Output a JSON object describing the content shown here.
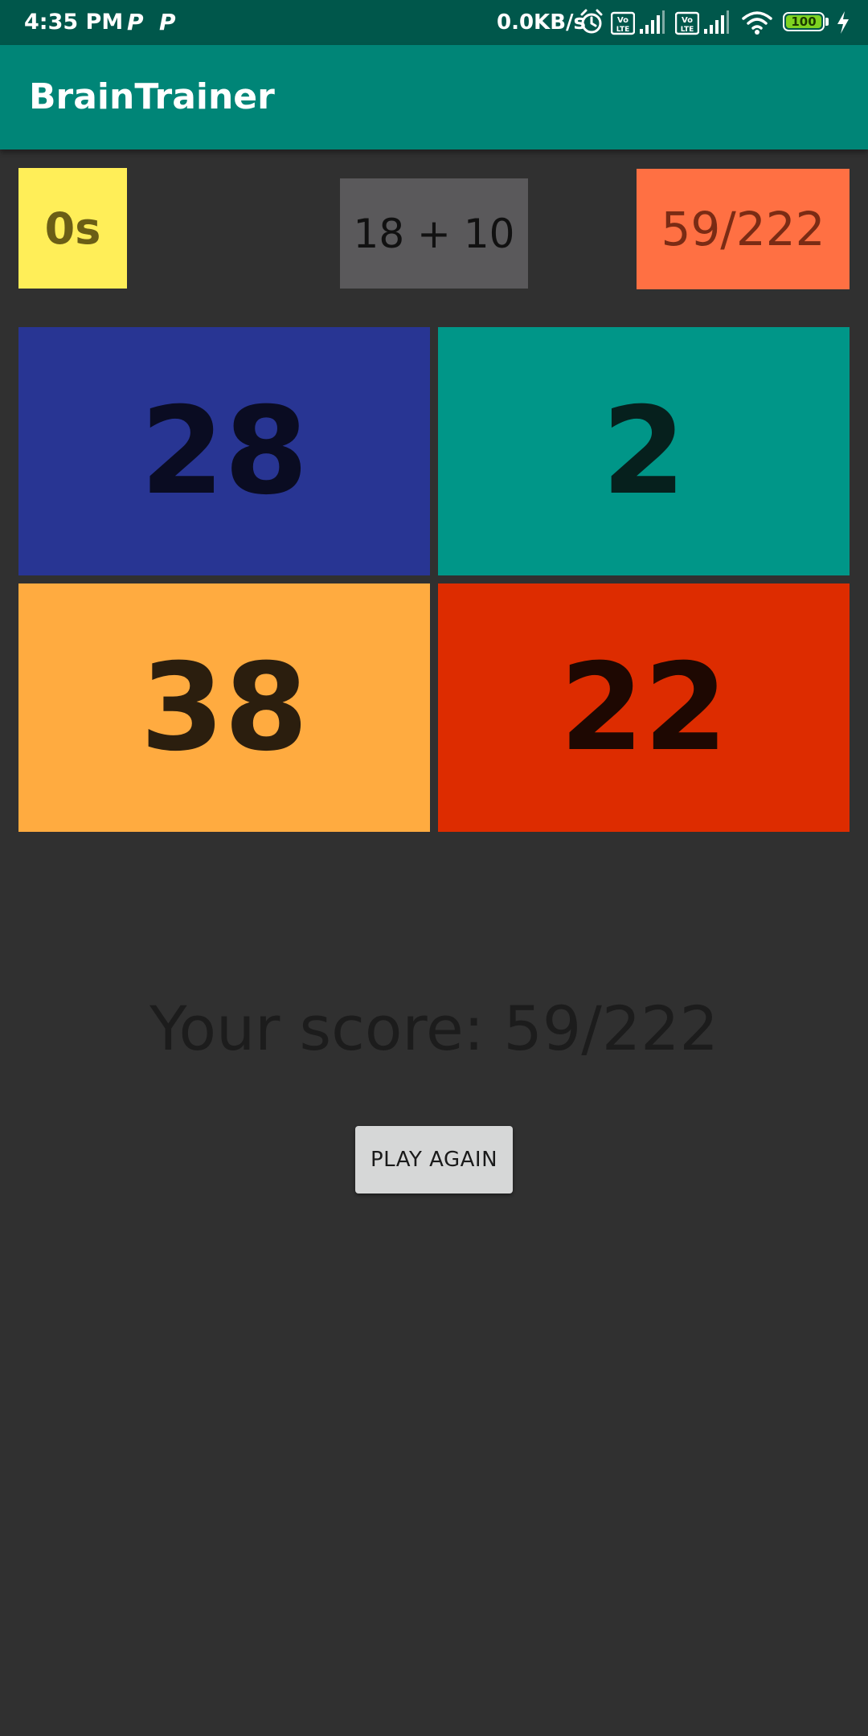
{
  "status_bar": {
    "time": "4:35 PM",
    "notification_icons": [
      "parking-p-icon",
      "parking-p-icon"
    ],
    "p_glyph": "P",
    "network_speed": "0.0KB/s",
    "icons": [
      "alarm-icon",
      "volte-icon",
      "signal-icon",
      "volte-icon",
      "signal-icon",
      "wifi-icon",
      "battery-icon",
      "charging-icon"
    ],
    "volte_label": "Vo LTE",
    "battery_level": "100",
    "battery_fraction": 1.0
  },
  "app_bar": {
    "title": "BrainTrainer"
  },
  "game": {
    "timer": "0s",
    "question": "18 + 10",
    "score": "59/222",
    "answers": [
      "28",
      "2",
      "38",
      "22"
    ],
    "result": "Your score: 59/222",
    "play_again_label": "PLAY AGAIN"
  },
  "colors": {
    "status_bar": "#00574b",
    "app_bar": "#008577",
    "background": "#303030",
    "timer": "#ffee58",
    "question": "#5a595b",
    "score": "#ff7043",
    "answer_0": "#283593",
    "answer_1": "#009688",
    "answer_2": "#ffab40",
    "answer_3": "#dd2c00",
    "battery_fill": "#7ed321"
  }
}
